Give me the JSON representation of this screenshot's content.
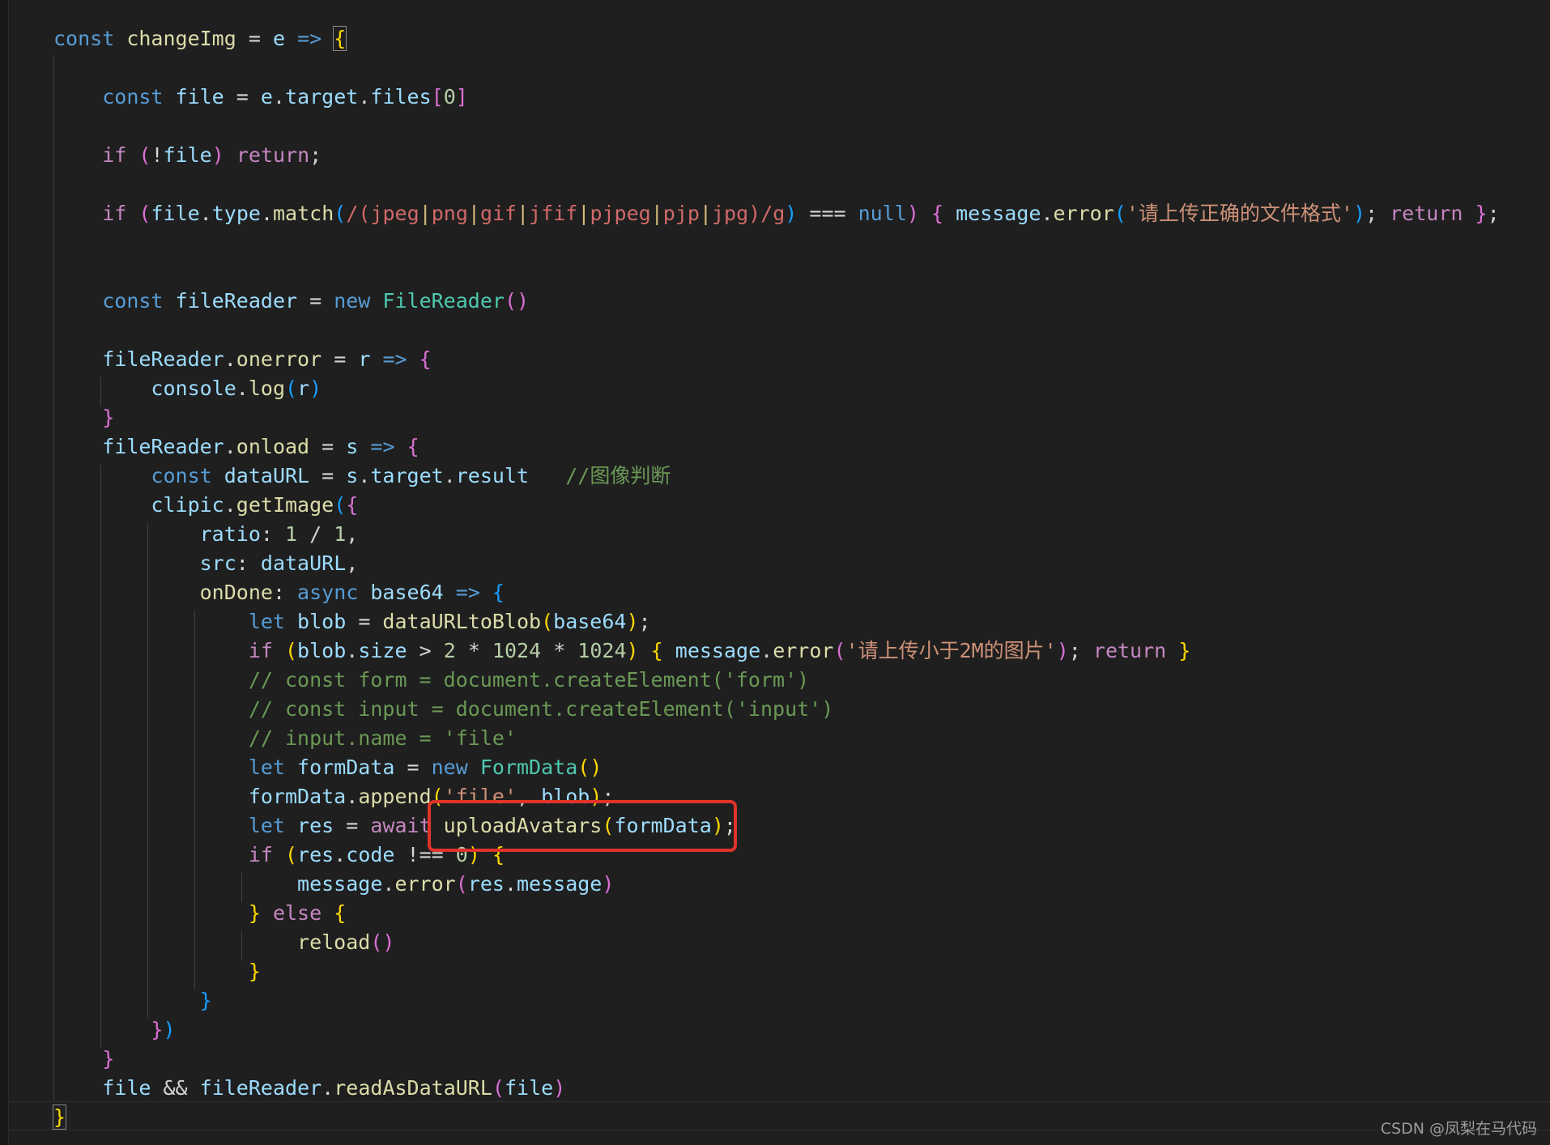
{
  "editor": {
    "lines": [
      [
        [
          "kw",
          "const "
        ],
        [
          "fn",
          "changeImg"
        ],
        [
          "txt",
          " = "
        ],
        [
          "var",
          "e"
        ],
        [
          "txt",
          " "
        ],
        [
          "kw",
          "=>"
        ],
        [
          "txt",
          " "
        ],
        [
          "b1",
          "{"
        ]
      ],
      [],
      [
        [
          "txt",
          "    "
        ],
        [
          "kw",
          "const "
        ],
        [
          "var",
          "file"
        ],
        [
          "txt",
          " = "
        ],
        [
          "var",
          "e"
        ],
        [
          "txt",
          "."
        ],
        [
          "var",
          "target"
        ],
        [
          "txt",
          "."
        ],
        [
          "var",
          "files"
        ],
        [
          "b2",
          "["
        ],
        [
          "num",
          "0"
        ],
        [
          "b2",
          "]"
        ]
      ],
      [],
      [
        [
          "txt",
          "    "
        ],
        [
          "ctl",
          "if "
        ],
        [
          "b2",
          "("
        ],
        [
          "txt",
          "!"
        ],
        [
          "var",
          "file"
        ],
        [
          "b2",
          ")"
        ],
        [
          "txt",
          " "
        ],
        [
          "ctl",
          "return"
        ],
        [
          "txt",
          ";"
        ]
      ],
      [],
      [
        [
          "txt",
          "    "
        ],
        [
          "ctl",
          "if "
        ],
        [
          "b2",
          "("
        ],
        [
          "var",
          "file"
        ],
        [
          "txt",
          "."
        ],
        [
          "var",
          "type"
        ],
        [
          "txt",
          "."
        ],
        [
          "fn",
          "match"
        ],
        [
          "b3",
          "("
        ],
        [
          "rx",
          "/("
        ],
        [
          "rx",
          "jpeg"
        ],
        [
          "rxop",
          "|"
        ],
        [
          "rx",
          "png"
        ],
        [
          "rxop",
          "|"
        ],
        [
          "rx",
          "gif"
        ],
        [
          "rxop",
          "|"
        ],
        [
          "rx",
          "jfif"
        ],
        [
          "rxop",
          "|"
        ],
        [
          "rx",
          "pjpeg"
        ],
        [
          "rxop",
          "|"
        ],
        [
          "rx",
          "pjp"
        ],
        [
          "rxop",
          "|"
        ],
        [
          "rx",
          "jpg"
        ],
        [
          "rx",
          ")/g"
        ],
        [
          "b3",
          ")"
        ],
        [
          "txt",
          " === "
        ],
        [
          "kw",
          "null"
        ],
        [
          "b2",
          ")"
        ],
        [
          "txt",
          " "
        ],
        [
          "b2",
          "{"
        ],
        [
          "txt",
          " "
        ],
        [
          "var",
          "message"
        ],
        [
          "txt",
          "."
        ],
        [
          "fn",
          "error"
        ],
        [
          "b3",
          "("
        ],
        [
          "str",
          "'请上传正确的文件格式'"
        ],
        [
          "b3",
          ")"
        ],
        [
          "txt",
          "; "
        ],
        [
          "ctl",
          "return"
        ],
        [
          "txt",
          " "
        ],
        [
          "b2",
          "}"
        ],
        [
          "txt",
          ";"
        ]
      ],
      [],
      [],
      [
        [
          "txt",
          "    "
        ],
        [
          "kw",
          "const "
        ],
        [
          "var",
          "fileReader"
        ],
        [
          "txt",
          " = "
        ],
        [
          "kw",
          "new "
        ],
        [
          "cls",
          "FileReader"
        ],
        [
          "b2",
          "()"
        ]
      ],
      [],
      [
        [
          "txt",
          "    "
        ],
        [
          "var",
          "fileReader"
        ],
        [
          "txt",
          "."
        ],
        [
          "fn",
          "onerror"
        ],
        [
          "txt",
          " = "
        ],
        [
          "var",
          "r"
        ],
        [
          "txt",
          " "
        ],
        [
          "kw",
          "=>"
        ],
        [
          "txt",
          " "
        ],
        [
          "b2",
          "{"
        ]
      ],
      [
        [
          "txt",
          "        "
        ],
        [
          "var",
          "console"
        ],
        [
          "txt",
          "."
        ],
        [
          "fn",
          "log"
        ],
        [
          "b3",
          "("
        ],
        [
          "var",
          "r"
        ],
        [
          "b3",
          ")"
        ]
      ],
      [
        [
          "txt",
          "    "
        ],
        [
          "b2",
          "}"
        ]
      ],
      [
        [
          "txt",
          "    "
        ],
        [
          "var",
          "fileReader"
        ],
        [
          "txt",
          "."
        ],
        [
          "fn",
          "onload"
        ],
        [
          "txt",
          " = "
        ],
        [
          "var",
          "s"
        ],
        [
          "txt",
          " "
        ],
        [
          "kw",
          "=>"
        ],
        [
          "txt",
          " "
        ],
        [
          "b2",
          "{"
        ]
      ],
      [
        [
          "txt",
          "        "
        ],
        [
          "kw",
          "const "
        ],
        [
          "var",
          "dataURL"
        ],
        [
          "txt",
          " = "
        ],
        [
          "var",
          "s"
        ],
        [
          "txt",
          "."
        ],
        [
          "var",
          "target"
        ],
        [
          "txt",
          "."
        ],
        [
          "var",
          "result"
        ],
        [
          "txt",
          "   "
        ],
        [
          "cmt",
          "//图像判断"
        ]
      ],
      [
        [
          "txt",
          "        "
        ],
        [
          "var",
          "clipic"
        ],
        [
          "txt",
          "."
        ],
        [
          "fn",
          "getImage"
        ],
        [
          "b3",
          "("
        ],
        [
          "b2",
          "{"
        ]
      ],
      [
        [
          "txt",
          "            "
        ],
        [
          "var",
          "ratio"
        ],
        [
          "txt",
          ": "
        ],
        [
          "num",
          "1"
        ],
        [
          "txt",
          " / "
        ],
        [
          "num",
          "1"
        ],
        [
          "txt",
          ","
        ]
      ],
      [
        [
          "txt",
          "            "
        ],
        [
          "var",
          "src"
        ],
        [
          "txt",
          ": "
        ],
        [
          "var",
          "dataURL"
        ],
        [
          "txt",
          ","
        ]
      ],
      [
        [
          "txt",
          "            "
        ],
        [
          "fn",
          "onDone"
        ],
        [
          "txt",
          ": "
        ],
        [
          "kw",
          "async "
        ],
        [
          "var",
          "base64"
        ],
        [
          "txt",
          " "
        ],
        [
          "kw",
          "=>"
        ],
        [
          "txt",
          " "
        ],
        [
          "b3",
          "{"
        ]
      ],
      [
        [
          "txt",
          "                "
        ],
        [
          "kw",
          "let "
        ],
        [
          "var",
          "blob"
        ],
        [
          "txt",
          " = "
        ],
        [
          "fn",
          "dataURLtoBlob"
        ],
        [
          "b1",
          "("
        ],
        [
          "var",
          "base64"
        ],
        [
          "b1",
          ")"
        ],
        [
          "txt",
          ";"
        ]
      ],
      [
        [
          "txt",
          "                "
        ],
        [
          "ctl",
          "if "
        ],
        [
          "b1",
          "("
        ],
        [
          "var",
          "blob"
        ],
        [
          "txt",
          "."
        ],
        [
          "var",
          "size"
        ],
        [
          "txt",
          " > "
        ],
        [
          "num",
          "2"
        ],
        [
          "txt",
          " * "
        ],
        [
          "num",
          "1024"
        ],
        [
          "txt",
          " * "
        ],
        [
          "num",
          "1024"
        ],
        [
          "b1",
          ")"
        ],
        [
          "txt",
          " "
        ],
        [
          "b1",
          "{"
        ],
        [
          "txt",
          " "
        ],
        [
          "var",
          "message"
        ],
        [
          "txt",
          "."
        ],
        [
          "fn",
          "error"
        ],
        [
          "b2",
          "("
        ],
        [
          "str",
          "'请上传小于2M的图片'"
        ],
        [
          "b2",
          ")"
        ],
        [
          "txt",
          "; "
        ],
        [
          "ctl",
          "return"
        ],
        [
          "txt",
          " "
        ],
        [
          "b1",
          "}"
        ]
      ],
      [
        [
          "txt",
          "                "
        ],
        [
          "cmt",
          "// const form = document.createElement('form')"
        ]
      ],
      [
        [
          "txt",
          "                "
        ],
        [
          "cmt",
          "// const input = document.createElement('input')"
        ]
      ],
      [
        [
          "txt",
          "                "
        ],
        [
          "cmt",
          "// input.name = 'file'"
        ]
      ],
      [
        [
          "txt",
          "                "
        ],
        [
          "kw",
          "let "
        ],
        [
          "var",
          "formData"
        ],
        [
          "txt",
          " = "
        ],
        [
          "kw",
          "new "
        ],
        [
          "cls",
          "FormData"
        ],
        [
          "b1",
          "()"
        ]
      ],
      [
        [
          "txt",
          "                "
        ],
        [
          "var",
          "formData"
        ],
        [
          "txt",
          "."
        ],
        [
          "fn",
          "append"
        ],
        [
          "b1",
          "("
        ],
        [
          "str",
          "'file'"
        ],
        [
          "txt",
          ", "
        ],
        [
          "var",
          "blob"
        ],
        [
          "b1",
          ")"
        ],
        [
          "txt",
          ";"
        ]
      ],
      [
        [
          "txt",
          "                "
        ],
        [
          "kw",
          "let "
        ],
        [
          "var",
          "res"
        ],
        [
          "txt",
          " = "
        ],
        [
          "ctl",
          "await "
        ],
        [
          "fn",
          "uploadAvatars"
        ],
        [
          "b1",
          "("
        ],
        [
          "var",
          "formData"
        ],
        [
          "b1",
          ")"
        ],
        [
          "txt",
          ";"
        ]
      ],
      [
        [
          "txt",
          "                "
        ],
        [
          "ctl",
          "if "
        ],
        [
          "b1",
          "("
        ],
        [
          "var",
          "res"
        ],
        [
          "txt",
          "."
        ],
        [
          "var",
          "code"
        ],
        [
          "txt",
          " !== "
        ],
        [
          "num",
          "0"
        ],
        [
          "b1",
          ")"
        ],
        [
          "txt",
          " "
        ],
        [
          "b1",
          "{"
        ]
      ],
      [
        [
          "txt",
          "                    "
        ],
        [
          "var",
          "message"
        ],
        [
          "txt",
          "."
        ],
        [
          "fn",
          "error"
        ],
        [
          "b2",
          "("
        ],
        [
          "var",
          "res"
        ],
        [
          "txt",
          "."
        ],
        [
          "var",
          "message"
        ],
        [
          "b2",
          ")"
        ]
      ],
      [
        [
          "txt",
          "                "
        ],
        [
          "b1",
          "}"
        ],
        [
          "txt",
          " "
        ],
        [
          "ctl",
          "else"
        ],
        [
          "txt",
          " "
        ],
        [
          "b1",
          "{"
        ]
      ],
      [
        [
          "txt",
          "                    "
        ],
        [
          "fn",
          "reload"
        ],
        [
          "b2",
          "()"
        ]
      ],
      [
        [
          "txt",
          "                "
        ],
        [
          "b1",
          "}"
        ]
      ],
      [
        [
          "txt",
          "            "
        ],
        [
          "b3",
          "}"
        ]
      ],
      [
        [
          "txt",
          "        "
        ],
        [
          "b2",
          "}"
        ],
        [
          "b3",
          ")"
        ]
      ],
      [
        [
          "txt",
          "    "
        ],
        [
          "b2",
          "}"
        ]
      ],
      [
        [
          "txt",
          "    "
        ],
        [
          "var",
          "file"
        ],
        [
          "txt",
          " && "
        ],
        [
          "var",
          "fileReader"
        ],
        [
          "txt",
          "."
        ],
        [
          "fn",
          "readAsDataURL"
        ],
        [
          "b2",
          "("
        ],
        [
          "var",
          "file"
        ],
        [
          "b2",
          ")"
        ]
      ],
      [
        [
          "b1",
          "}"
        ]
      ]
    ]
  },
  "watermark": "CSDN @凤梨在马代码",
  "colors": {
    "background": "#1f1f1f",
    "highlight_box": "#e0332a"
  }
}
